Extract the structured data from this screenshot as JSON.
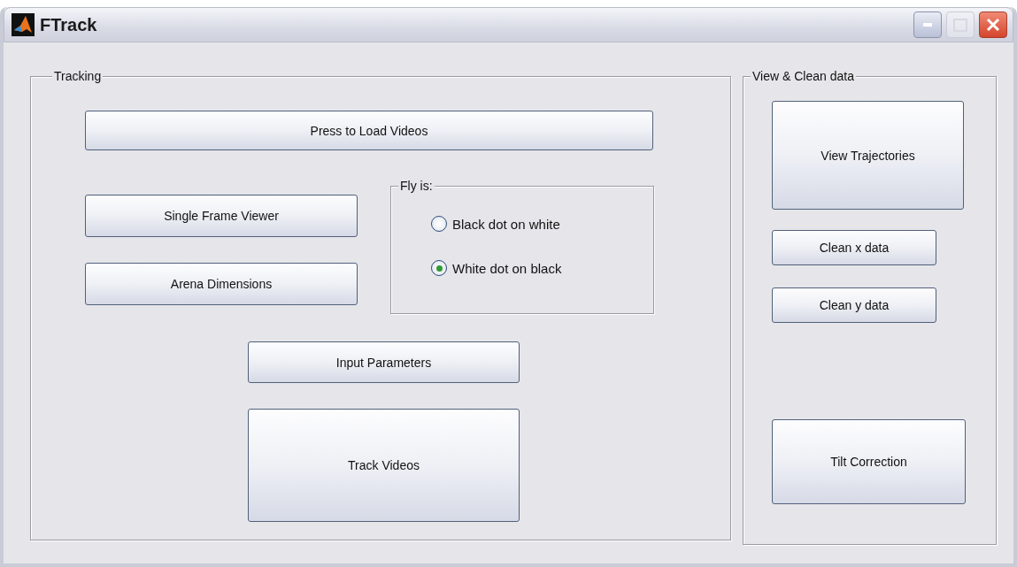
{
  "window": {
    "title": "FTrack"
  },
  "tracking": {
    "title": "Tracking",
    "load_button": "Press to Load Videos",
    "frame_viewer_button": "Single Frame Viewer",
    "arena_button": "Arena Dimensions",
    "fly_group": {
      "title": "Fly is:",
      "options": [
        {
          "label": "Black dot on white",
          "selected": false
        },
        {
          "label": "White dot on black",
          "selected": true
        }
      ]
    },
    "parameters_button": "Input Parameters",
    "track_button": "Track Videos"
  },
  "view_clean": {
    "title": "View & Clean data",
    "trajectories_button": "View Trajectories",
    "clean_x_button": "Clean x data",
    "clean_y_button": "Clean y data",
    "tilt_button": "Tilt Correction"
  }
}
